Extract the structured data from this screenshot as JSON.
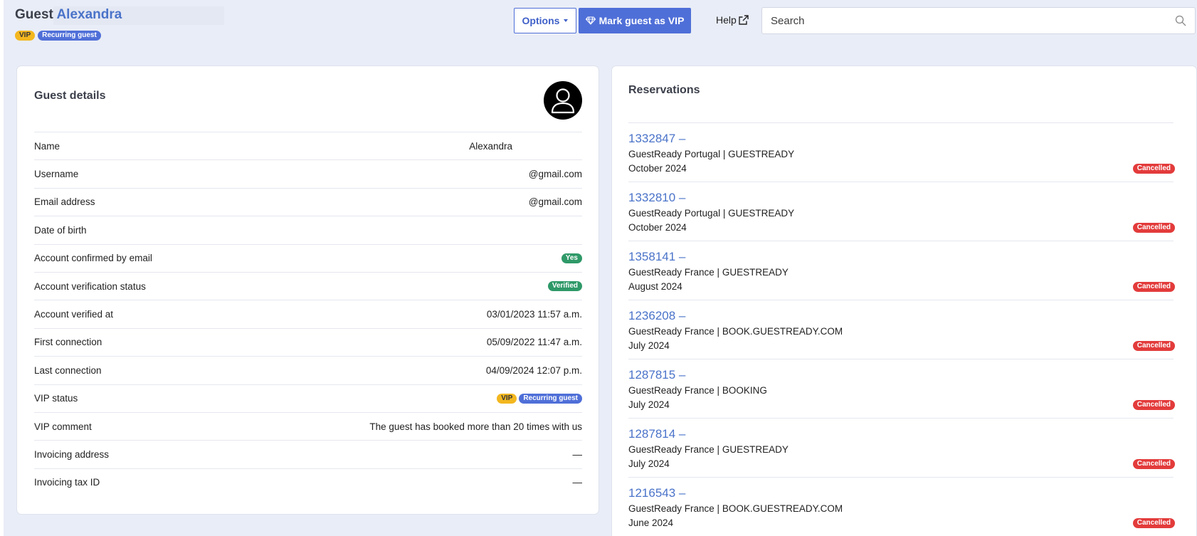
{
  "header": {
    "title_prefix": "Guest",
    "guest_name": "Alexandra",
    "badges": {
      "vip": "VIP",
      "recurring": "Recurring guest"
    },
    "options_label": "Options",
    "vip_button_label": "Mark guest as VIP",
    "help_label": "Help",
    "search_placeholder": "Search"
  },
  "guest_details": {
    "title": "Guest details",
    "rows": [
      {
        "label": "Name",
        "value": "Alexandra"
      },
      {
        "label": "Username",
        "value": "@gmail.com"
      },
      {
        "label": "Email address",
        "value": "@gmail.com"
      },
      {
        "label": "Date of birth",
        "value": ""
      },
      {
        "label": "Account confirmed by email",
        "value": "Yes"
      },
      {
        "label": "Account verification status",
        "value": "Verified"
      },
      {
        "label": "Account verified at",
        "value": "03/01/2023 11:57 a.m."
      },
      {
        "label": "First connection",
        "value": "05/09/2022 11:47 a.m."
      },
      {
        "label": "Last connection",
        "value": "04/09/2024 12:07 p.m."
      },
      {
        "label": "VIP status",
        "value": [
          "VIP",
          "Recurring guest"
        ]
      },
      {
        "label": "VIP comment",
        "value": "The guest has booked more than 20 times with us"
      },
      {
        "label": "Invoicing address",
        "value": "—"
      },
      {
        "label": "Invoicing tax ID",
        "value": "—"
      }
    ]
  },
  "reservations": {
    "title": "Reservations",
    "items": [
      {
        "id": "1332847 –",
        "property": "GuestReady Portugal | GUESTREADY",
        "date": "October 2024",
        "status": "Cancelled"
      },
      {
        "id": "1332810 –",
        "property": "GuestReady Portugal | GUESTREADY",
        "date": "October 2024",
        "status": "Cancelled"
      },
      {
        "id": "1358141 –",
        "property": "GuestReady France | GUESTREADY",
        "date": "August 2024",
        "status": "Cancelled"
      },
      {
        "id": "1236208 –",
        "property": "GuestReady France | BOOK.GUESTREADY.COM",
        "date": "July 2024",
        "status": "Cancelled"
      },
      {
        "id": "1287815 –",
        "property": "GuestReady France | BOOKING",
        "date": "July 2024",
        "status": "Cancelled"
      },
      {
        "id": "1287814 –",
        "property": "GuestReady France | GUESTREADY",
        "date": "July 2024",
        "status": "Cancelled"
      },
      {
        "id": "1216543 –",
        "property": "GuestReady France | BOOK.GUESTREADY.COM",
        "date": "June 2024",
        "status": "Cancelled"
      }
    ]
  }
}
